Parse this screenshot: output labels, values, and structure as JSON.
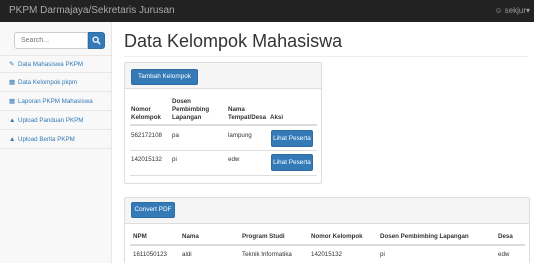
{
  "navbar": {
    "brand": "PKPM Darmajaya/Sekretaris Jurusan",
    "user": "sekjur"
  },
  "sidebar": {
    "search_placeholder": "Search...",
    "items": [
      {
        "icon": "edit-icon",
        "label": "Data Mahasiswa PKPM"
      },
      {
        "icon": "table-icon",
        "label": "Data Kelompok pkpm"
      },
      {
        "icon": "table-icon",
        "label": "Laporan PKPM Mahasiswa"
      },
      {
        "icon": "upload-icon",
        "label": "Upload Panduan PKPM"
      },
      {
        "icon": "upload-icon",
        "label": "Upload Berita PKPM"
      }
    ]
  },
  "main": {
    "title": "Data Kelompok Mahasiswa",
    "kelompok_panel": {
      "add_button": "Tambah Kelompok",
      "headers": [
        "Nomor Kelompok",
        "Dosen Pembimbing Lapangan",
        "Nama Tempat/Desa",
        "Aksi"
      ],
      "header_lines": [
        [
          "Nomor",
          "Kelompok"
        ],
        [
          "Dosen",
          "Pembimbing",
          "Lapangan"
        ],
        [
          "Nama",
          "Tempat/Desa"
        ],
        [
          "Aksi"
        ]
      ],
      "rows": [
        {
          "nomor": "562172108",
          "dosen": "pa",
          "tempat": "lampung",
          "action": "Lihat Peserta"
        },
        {
          "nomor": "142015132",
          "dosen": "pi",
          "tempat": "edw",
          "action": "Lihat Peserta"
        }
      ]
    },
    "peserta_panel": {
      "convert_button": "Convert PDF",
      "headers": [
        "NPM",
        "Nama",
        "Program Studi",
        "Nomor Kelompok",
        "Dosen Pembimbing Lapangan",
        "Desa"
      ],
      "rows": [
        {
          "npm": "1611050123",
          "nama": "aldi",
          "prodi": "Teknik Informatika",
          "nomor": "142015132",
          "dosen": "pi",
          "desa": "edw"
        }
      ]
    }
  }
}
